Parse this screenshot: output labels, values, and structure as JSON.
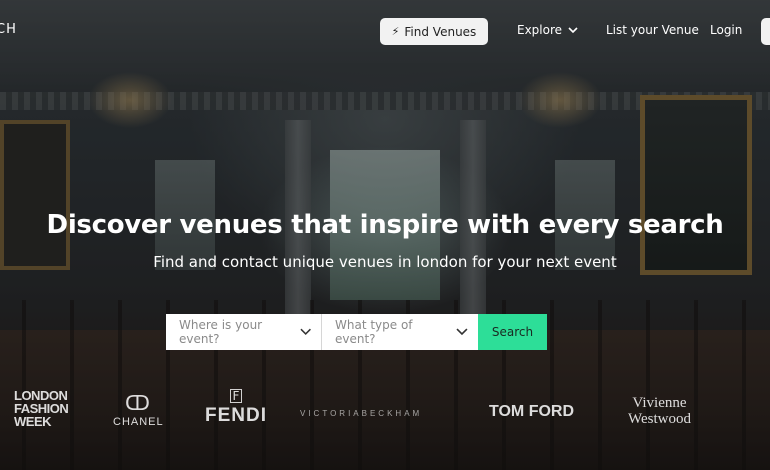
{
  "nav": {
    "brand": "CH",
    "find_venues": "Find Venues",
    "explore": "Explore",
    "list_venue": "List your Venue",
    "login": "Login"
  },
  "hero": {
    "title": "Discover venues that inspire with every search",
    "subtitle": "Find and contact unique venues in london for your next event"
  },
  "search": {
    "where_placeholder": "Where is your event?",
    "type_placeholder": "What type of event?",
    "button": "Search"
  },
  "logos": {
    "lfw_line1": "LONDON",
    "lfw_line2": "FASHION",
    "lfw_line3": "WEEK",
    "chanel": "CHANEL",
    "fendi": "FENDI",
    "victoria_beckham": "VICTORIABECKHAM",
    "tom_ford": "TOM FORD",
    "vw_line1": "Vivienne",
    "vw_line2": "Westwood"
  },
  "colors": {
    "accent": "#2dde98",
    "nav_button_bg": "#f2f2f2"
  },
  "icons": {
    "find_venues": "bolt-icon",
    "explore": "chevron-down-icon",
    "where": "chevron-down-icon",
    "type": "chevron-down-icon"
  }
}
